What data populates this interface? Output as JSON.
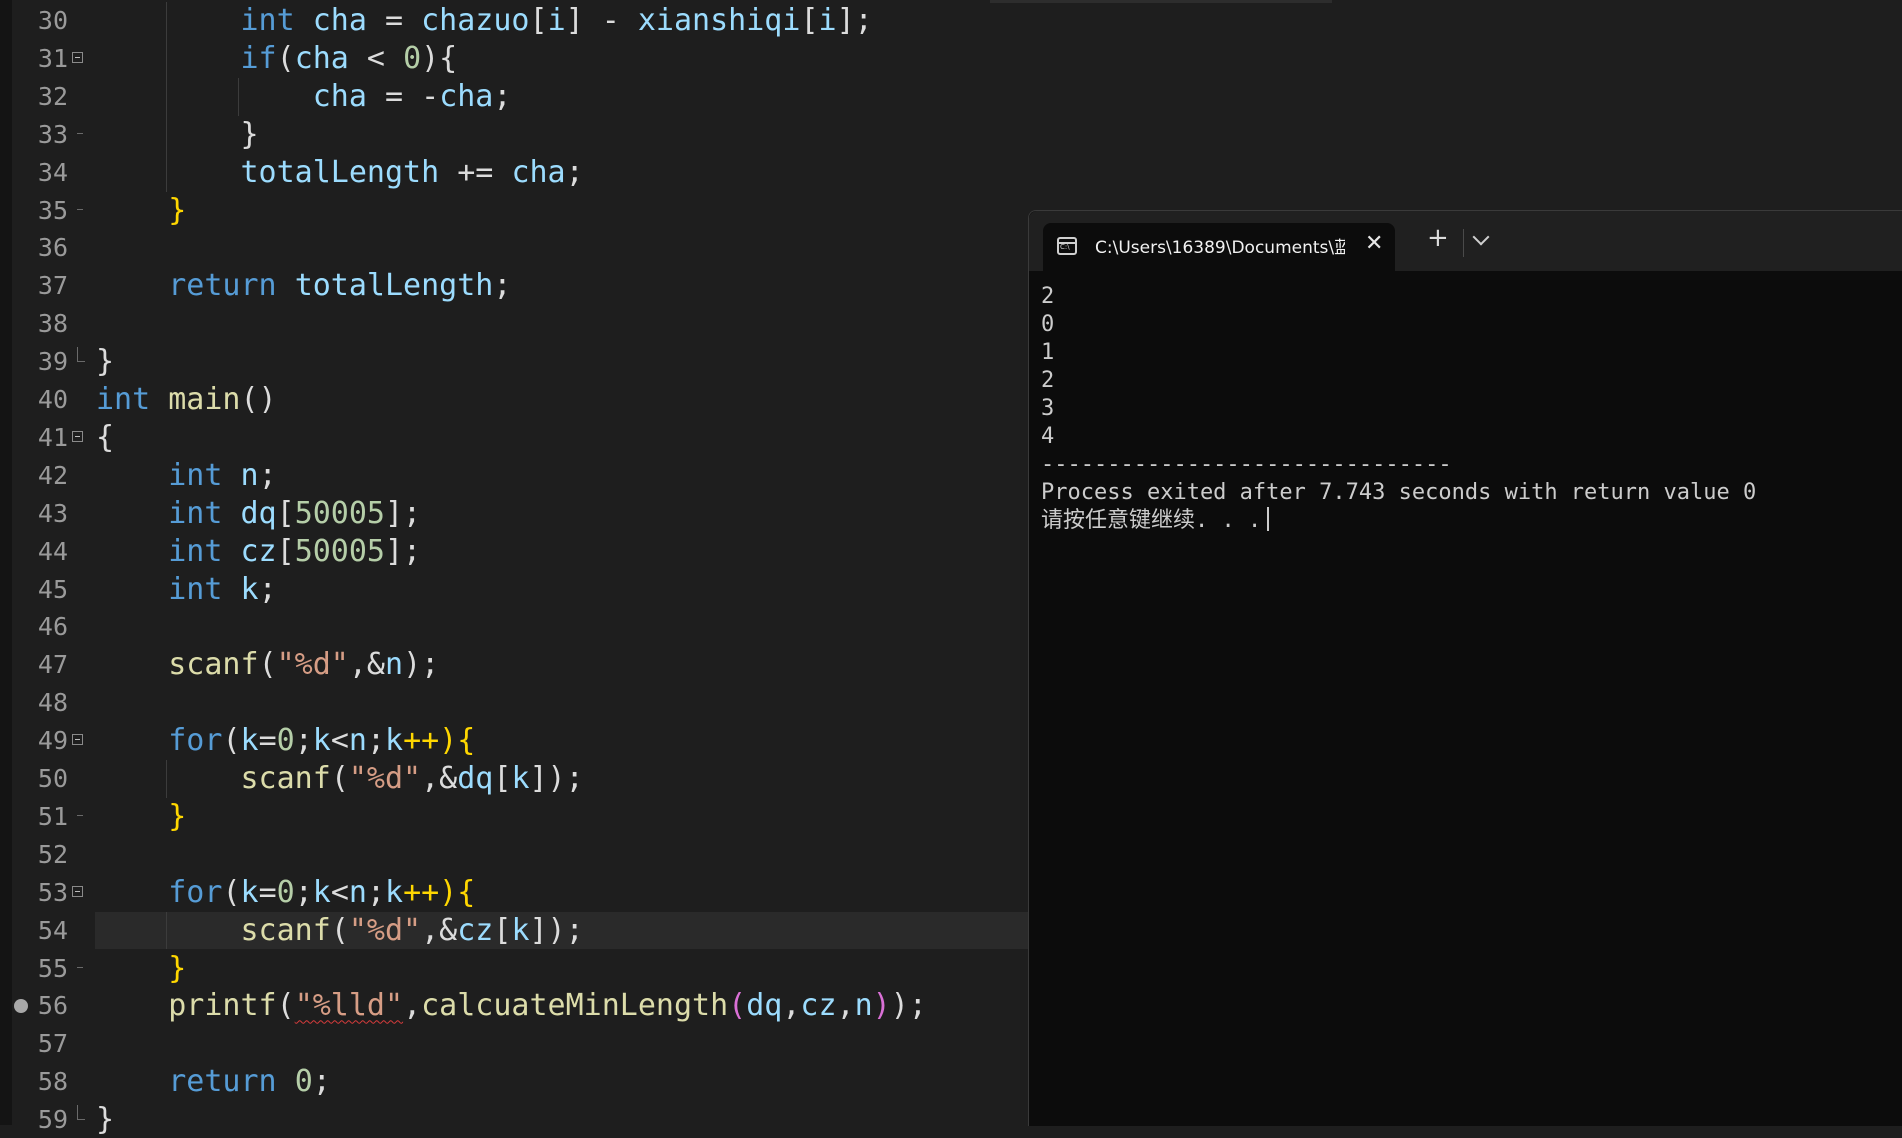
{
  "editor": {
    "current_line": 54,
    "breakpoint_line": 56
  },
  "terminal": {
    "tab_title": "C:\\Users\\16389\\Documents\\蓝",
    "output_lines": [
      "2",
      "0",
      "1",
      "2",
      "3",
      "4",
      "-------------------------------",
      "Process exited after 7.743 seconds with return value 0"
    ],
    "prompt": "请按任意键继续. . ."
  },
  "code_lines": [
    {
      "n": "30",
      "fold": "",
      "tokens": [
        [
          "        ",
          ""
        ],
        [
          "int",
          "kw"
        ],
        [
          " ",
          ""
        ],
        [
          "cha",
          "id"
        ],
        [
          " = ",
          "op"
        ],
        [
          "chazuo",
          "id"
        ],
        [
          "[",
          "op"
        ],
        [
          "i",
          "id"
        ],
        [
          "] - ",
          "op"
        ],
        [
          "xianshiqi",
          "id"
        ],
        [
          "[",
          "op"
        ],
        [
          "i",
          "id"
        ],
        [
          "];",
          "op"
        ]
      ]
    },
    {
      "n": "31",
      "fold": "open",
      "tokens": [
        [
          "        ",
          ""
        ],
        [
          "if",
          "kw"
        ],
        [
          "(",
          "op"
        ],
        [
          "cha",
          "id"
        ],
        [
          " < ",
          "op"
        ],
        [
          "0",
          "num"
        ],
        [
          "){",
          "op"
        ]
      ]
    },
    {
      "n": "32",
      "fold": "",
      "tokens": [
        [
          "            ",
          ""
        ],
        [
          "cha",
          "id"
        ],
        [
          " = -",
          "op"
        ],
        [
          "cha",
          "id"
        ],
        [
          ";",
          "op"
        ]
      ]
    },
    {
      "n": "33",
      "fold": "tick",
      "tokens": [
        [
          "        ",
          ""
        ],
        [
          "}",
          "op"
        ]
      ]
    },
    {
      "n": "34",
      "fold": "",
      "tokens": [
        [
          "        ",
          ""
        ],
        [
          "totalLength",
          "id"
        ],
        [
          " += ",
          "op"
        ],
        [
          "cha",
          "id"
        ],
        [
          ";",
          "op"
        ]
      ]
    },
    {
      "n": "35",
      "fold": "tick",
      "tokens": [
        [
          "    ",
          ""
        ],
        [
          "}",
          "br"
        ]
      ]
    },
    {
      "n": "36",
      "fold": "",
      "tokens": []
    },
    {
      "n": "37",
      "fold": "",
      "tokens": [
        [
          "    ",
          ""
        ],
        [
          "return",
          "kw"
        ],
        [
          " ",
          ""
        ],
        [
          "totalLength",
          "id"
        ],
        [
          ";",
          "op"
        ]
      ]
    },
    {
      "n": "38",
      "fold": "",
      "tokens": []
    },
    {
      "n": "39",
      "fold": "end",
      "tokens": [
        [
          "}",
          "op"
        ]
      ]
    },
    {
      "n": "40",
      "fold": "",
      "tokens": [
        [
          "int",
          "kw"
        ],
        [
          " ",
          ""
        ],
        [
          "main",
          "fn"
        ],
        [
          "()",
          "op"
        ]
      ]
    },
    {
      "n": "41",
      "fold": "open",
      "tokens": [
        [
          "{",
          "op"
        ]
      ]
    },
    {
      "n": "42",
      "fold": "",
      "tokens": [
        [
          "    ",
          ""
        ],
        [
          "int",
          "kw"
        ],
        [
          " ",
          ""
        ],
        [
          "n",
          "id"
        ],
        [
          ";",
          "op"
        ]
      ]
    },
    {
      "n": "43",
      "fold": "",
      "tokens": [
        [
          "    ",
          ""
        ],
        [
          "int",
          "kw"
        ],
        [
          " ",
          ""
        ],
        [
          "dq",
          "id"
        ],
        [
          "[",
          "op"
        ],
        [
          "50005",
          "num"
        ],
        [
          "];",
          "op"
        ]
      ]
    },
    {
      "n": "44",
      "fold": "",
      "tokens": [
        [
          "    ",
          ""
        ],
        [
          "int",
          "kw"
        ],
        [
          " ",
          ""
        ],
        [
          "cz",
          "id"
        ],
        [
          "[",
          "op"
        ],
        [
          "50005",
          "num"
        ],
        [
          "];",
          "op"
        ]
      ]
    },
    {
      "n": "45",
      "fold": "",
      "tokens": [
        [
          "    ",
          ""
        ],
        [
          "int",
          "kw"
        ],
        [
          " ",
          ""
        ],
        [
          "k",
          "id"
        ],
        [
          ";",
          "op"
        ]
      ]
    },
    {
      "n": "46",
      "fold": "",
      "tokens": []
    },
    {
      "n": "47",
      "fold": "",
      "tokens": [
        [
          "    ",
          ""
        ],
        [
          "scanf",
          "fn"
        ],
        [
          "(",
          "op"
        ],
        [
          "\"%d\"",
          "str"
        ],
        [
          ",&",
          "op"
        ],
        [
          "n",
          "id"
        ],
        [
          ");",
          "op"
        ]
      ]
    },
    {
      "n": "48",
      "fold": "",
      "tokens": []
    },
    {
      "n": "49",
      "fold": "open",
      "tokens": [
        [
          "    ",
          ""
        ],
        [
          "for",
          "kw"
        ],
        [
          "(",
          "op"
        ],
        [
          "k",
          "id"
        ],
        [
          "=",
          "op"
        ],
        [
          "0",
          "num"
        ],
        [
          ";",
          "op"
        ],
        [
          "k",
          "id"
        ],
        [
          "<",
          "op"
        ],
        [
          "n",
          "id"
        ],
        [
          ";",
          "op"
        ],
        [
          "k",
          "id"
        ],
        [
          "++){",
          "br"
        ]
      ]
    },
    {
      "n": "50",
      "fold": "",
      "tokens": [
        [
          "        ",
          ""
        ],
        [
          "scanf",
          "fn"
        ],
        [
          "(",
          "op"
        ],
        [
          "\"%d\"",
          "str"
        ],
        [
          ",&",
          "op"
        ],
        [
          "dq",
          "id"
        ],
        [
          "[",
          "op"
        ],
        [
          "k",
          "id"
        ],
        [
          "]);",
          "op"
        ]
      ]
    },
    {
      "n": "51",
      "fold": "tick",
      "tokens": [
        [
          "    ",
          ""
        ],
        [
          "}",
          "br"
        ]
      ]
    },
    {
      "n": "52",
      "fold": "",
      "tokens": []
    },
    {
      "n": "53",
      "fold": "open",
      "tokens": [
        [
          "    ",
          ""
        ],
        [
          "for",
          "kw"
        ],
        [
          "(",
          "op"
        ],
        [
          "k",
          "id"
        ],
        [
          "=",
          "op"
        ],
        [
          "0",
          "num"
        ],
        [
          ";",
          "op"
        ],
        [
          "k",
          "id"
        ],
        [
          "<",
          "op"
        ],
        [
          "n",
          "id"
        ],
        [
          ";",
          "op"
        ],
        [
          "k",
          "id"
        ],
        [
          "++){",
          "br"
        ]
      ]
    },
    {
      "n": "54",
      "fold": "",
      "tokens": [
        [
          "        ",
          ""
        ],
        [
          "scanf",
          "fn"
        ],
        [
          "(",
          "op"
        ],
        [
          "\"%d\"",
          "str"
        ],
        [
          ",&",
          "op"
        ],
        [
          "cz",
          "id"
        ],
        [
          "[",
          "op"
        ],
        [
          "k",
          "id"
        ],
        [
          "]);",
          "op"
        ]
      ]
    },
    {
      "n": "55",
      "fold": "tick",
      "tokens": [
        [
          "    ",
          ""
        ],
        [
          "}",
          "br"
        ]
      ]
    },
    {
      "n": "56",
      "fold": "",
      "tokens": [
        [
          "    ",
          ""
        ],
        [
          "printf",
          "fn"
        ],
        [
          "(",
          "op"
        ],
        [
          "\"%lld\"",
          "str squig"
        ],
        [
          ",",
          "op"
        ],
        [
          "calcuateMinLength",
          "fn"
        ],
        [
          "(",
          "br2"
        ],
        [
          "dq",
          "id"
        ],
        [
          ",",
          "op"
        ],
        [
          "cz",
          "id"
        ],
        [
          ",",
          "op"
        ],
        [
          "n",
          "id"
        ],
        [
          ")",
          "br2"
        ],
        [
          ");",
          "op"
        ]
      ]
    },
    {
      "n": "57",
      "fold": "",
      "tokens": []
    },
    {
      "n": "58",
      "fold": "",
      "tokens": [
        [
          "    ",
          ""
        ],
        [
          "return",
          "kw"
        ],
        [
          " ",
          ""
        ],
        [
          "0",
          "num"
        ],
        [
          ";",
          "op"
        ]
      ]
    },
    {
      "n": "59",
      "fold": "end",
      "tokens": [
        [
          "}",
          "op"
        ]
      ]
    }
  ]
}
